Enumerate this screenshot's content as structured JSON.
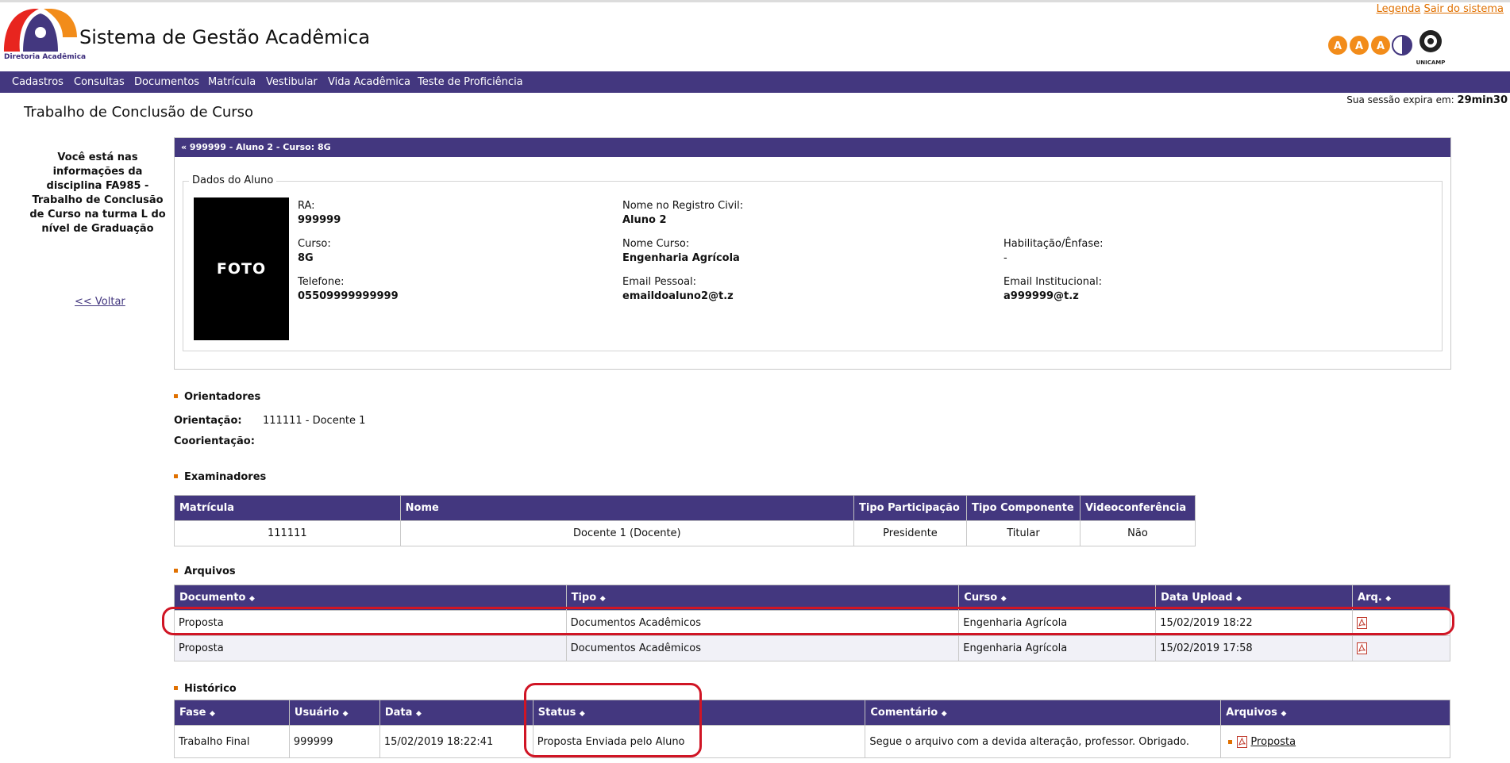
{
  "header": {
    "system_title": "Sistema de Gestão Acadêmica",
    "logo_caption": "Diretoria Acadêmica",
    "links": {
      "legend": "Legenda",
      "logout": "Sair do sistema"
    },
    "brand": {
      "badge_letter": "A",
      "unicamp": "UNICAMP"
    }
  },
  "menu": [
    "Cadastros",
    "Consultas",
    "Documentos",
    "Matrícula",
    "Vestibular",
    "Vida Acadêmica",
    "Teste de Proficiência"
  ],
  "page": {
    "title": "Trabalho de Conclusão de Curso",
    "session_label": "Sua sessão expira em:",
    "session_value": "29min30"
  },
  "side": {
    "info": "Você está nas informações da disciplina FA985 - Trabalho de Conclusão de Curso na turma L do nível de Graduação",
    "back": "<< Voltar"
  },
  "student_panel": {
    "header": "« 999999 - Aluno 2 - Curso: 8G",
    "legend": "Dados do Aluno",
    "photo": "FOTO",
    "ra_label": "RA:",
    "ra": "999999",
    "curso_label": "Curso:",
    "curso": "8G",
    "telefone_label": "Telefone:",
    "telefone": "05509999999999",
    "nome_label": "Nome no Registro Civil:",
    "nome": "Aluno 2",
    "nome_curso_label": "Nome Curso:",
    "nome_curso": "Engenharia Agrícola",
    "email_pessoal_label": "Email Pessoal:",
    "email_pessoal": "emaildoaluno2@t.z",
    "habilitacao_label": "Habilitação/Ênfase:",
    "habilitacao": "-",
    "email_inst_label": "Email Institucional:",
    "email_inst": "a999999@t.z"
  },
  "orientadores": {
    "title": "Orientadores",
    "orientacao_label": "Orientação:",
    "orientacao": "111111 - Docente 1",
    "coorientacao_label": "Coorientação:"
  },
  "examinadores": {
    "title": "Examinadores",
    "columns": [
      "Matrícula",
      "Nome",
      "Tipo Participação",
      "Tipo Componente",
      "Videoconferência"
    ],
    "rows": [
      [
        "111111",
        "Docente 1 (Docente)",
        "Presidente",
        "Titular",
        "Não"
      ]
    ]
  },
  "arquivos": {
    "title": "Arquivos",
    "columns": [
      "Documento",
      "Tipo",
      "Curso",
      "Data Upload",
      "Arq."
    ],
    "rows": [
      [
        "Proposta",
        "Documentos Acadêmicos",
        "Engenharia Agrícola",
        "15/02/2019 18:22"
      ],
      [
        "Proposta",
        "Documentos Acadêmicos",
        "Engenharia Agrícola",
        "15/02/2019 17:58"
      ]
    ]
  },
  "historico": {
    "title": "Histórico",
    "columns": [
      "Fase",
      "Usuário",
      "Data",
      "Status",
      "Comentário",
      "Arquivos"
    ],
    "rows": [
      [
        "Trabalho Final",
        "999999",
        "15/02/2019 18:22:41",
        "Proposta Enviada pelo Aluno",
        "Segue o arquivo com a devida alteração, professor. Obrigado.",
        "Proposta"
      ]
    ]
  },
  "sort_glyph": "◆",
  "colors": {
    "accent": "#43377f",
    "orange": "#e07000",
    "highlight": "#d01525"
  }
}
